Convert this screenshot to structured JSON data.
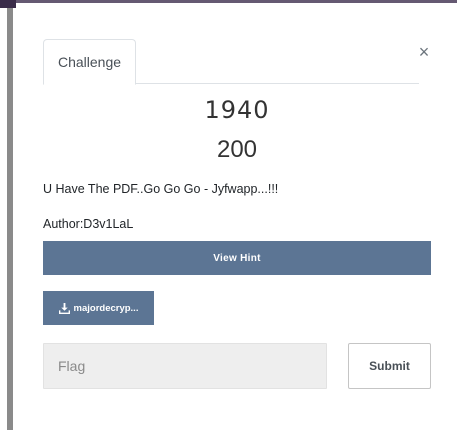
{
  "modal": {
    "tab_label": "Challenge",
    "close_label": "×"
  },
  "challenge": {
    "name": "1940",
    "value": "200",
    "description": "U Have The PDF..Go Go Go - Jyfwapp...!!!",
    "author": "Author:D3v1LaL"
  },
  "actions": {
    "hint_label": "View Hint",
    "file_label": "majordecryp..."
  },
  "flag_form": {
    "placeholder": "Flag",
    "submit_label": "Submit"
  },
  "colors": {
    "button_bg": "#5c7594",
    "input_bg": "#eeeeee",
    "top_bar": "#3a2c49"
  },
  "icons": {
    "file_button": "download-icon"
  }
}
